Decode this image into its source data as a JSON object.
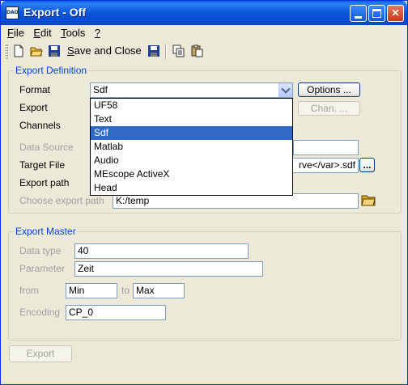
{
  "window": {
    "title": "Export - Off",
    "icon_label": "DAO"
  },
  "menu": [
    {
      "label": "File",
      "u": "F",
      "rest": "ile"
    },
    {
      "label": "Edit",
      "u": "E",
      "rest": "dit"
    },
    {
      "label": "Tools",
      "u": "T",
      "rest": "ools"
    },
    {
      "label": "?",
      "u": "?",
      "rest": ""
    }
  ],
  "toolbar": {
    "save_and_close_u": "S",
    "save_and_close_rest": "ave and Close"
  },
  "export_definition": {
    "title": "Export Definition",
    "format_label": "Format",
    "format_value": "Sdf",
    "options_button": "Options ...",
    "export_label": "Export",
    "channels_label": "Channels",
    "chan_button": "Chan. ...",
    "data_source_label": "Data Source",
    "target_file_label": "Target File",
    "target_file_value": "rve</var>.sdf",
    "target_browse_button": "...",
    "export_path_label": "Export path",
    "choose_export_path_label": "Choose export path",
    "choose_export_path_value": "K:/temp",
    "format_options": [
      "UF58",
      "Text",
      "Sdf",
      "Matlab",
      "Audio",
      "MEscope ActiveX",
      "Head"
    ],
    "selected_index": 2
  },
  "export_master": {
    "title": "Export Master",
    "data_type_label": "Data type",
    "data_type_value": "40",
    "parameter_label": "Parameter",
    "parameter_value": "Zeit",
    "from_label": "from",
    "from_value": "Min",
    "to_label": "to",
    "to_value": "Max",
    "encoding_label": "Encoding",
    "encoding_value": "CP_0"
  },
  "export_button": "Export"
}
